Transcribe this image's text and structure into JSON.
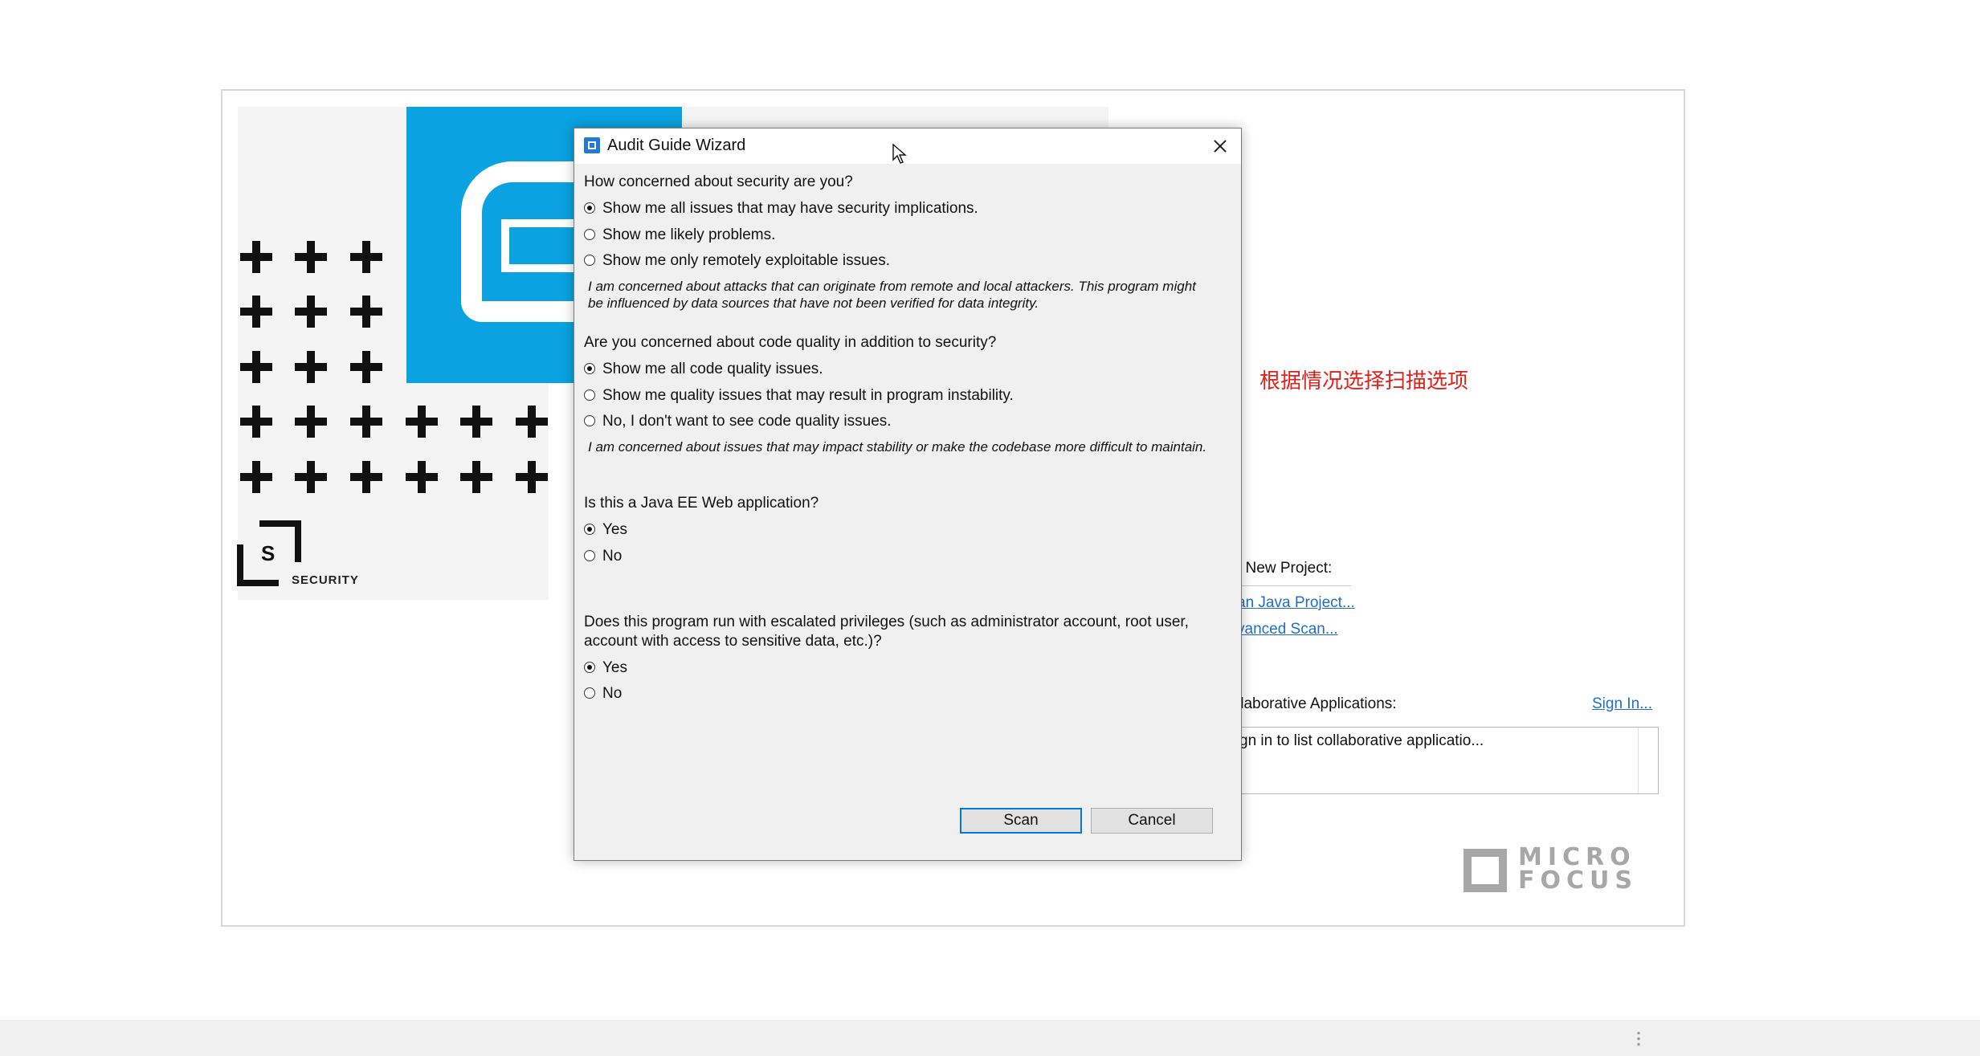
{
  "dialog": {
    "title": "Audit Guide Wizard",
    "q1": {
      "question": "How concerned about security are you?",
      "options": [
        "Show me all issues that may have security implications.",
        "Show me likely problems.",
        "Show me only remotely exploitable issues."
      ],
      "selected": 0,
      "note": "I am concerned about attacks that can originate from remote and local attackers. This program might be influenced by data sources that have not been verified for data integrity."
    },
    "q2": {
      "question": "Are you concerned about code quality in addition to security?",
      "options": [
        "Show me all code quality issues.",
        "Show me quality issues that may result in program instability.",
        "No, I don't want to see code quality issues."
      ],
      "selected": 0,
      "note": "I am concerned about issues that may impact stability or make the codebase more difficult to maintain."
    },
    "q3": {
      "question": "Is this a Java EE Web application?",
      "options": [
        "Yes",
        "No"
      ],
      "selected": 0
    },
    "q4": {
      "question": "Does this program run with escalated privileges (such as administrator account, root user, account with access to sensitive data, etc.)?",
      "options": [
        "Yes",
        "No"
      ],
      "selected": 0
    },
    "scan_label": "Scan",
    "cancel_label": "Cancel"
  },
  "background": {
    "annotation": "根据情况选择扫描选项",
    "new_project_label": "t New Project:",
    "links": [
      "an Java Project...",
      "vanced Scan..."
    ],
    "collab_label": "llaborative Applications:",
    "sign_in": "Sign In...",
    "collab_box_text": "gn in to list collaborative applicatio...",
    "security_logo_letter": "S",
    "security_word": "SECURITY",
    "brand_logo": "MICRO FOCUS"
  },
  "colors": {
    "brand_blue": "#0aa2e0",
    "link": "#1f6fc5",
    "annotation_red": "#e0211b",
    "primary_button_border": "#0078d7"
  }
}
